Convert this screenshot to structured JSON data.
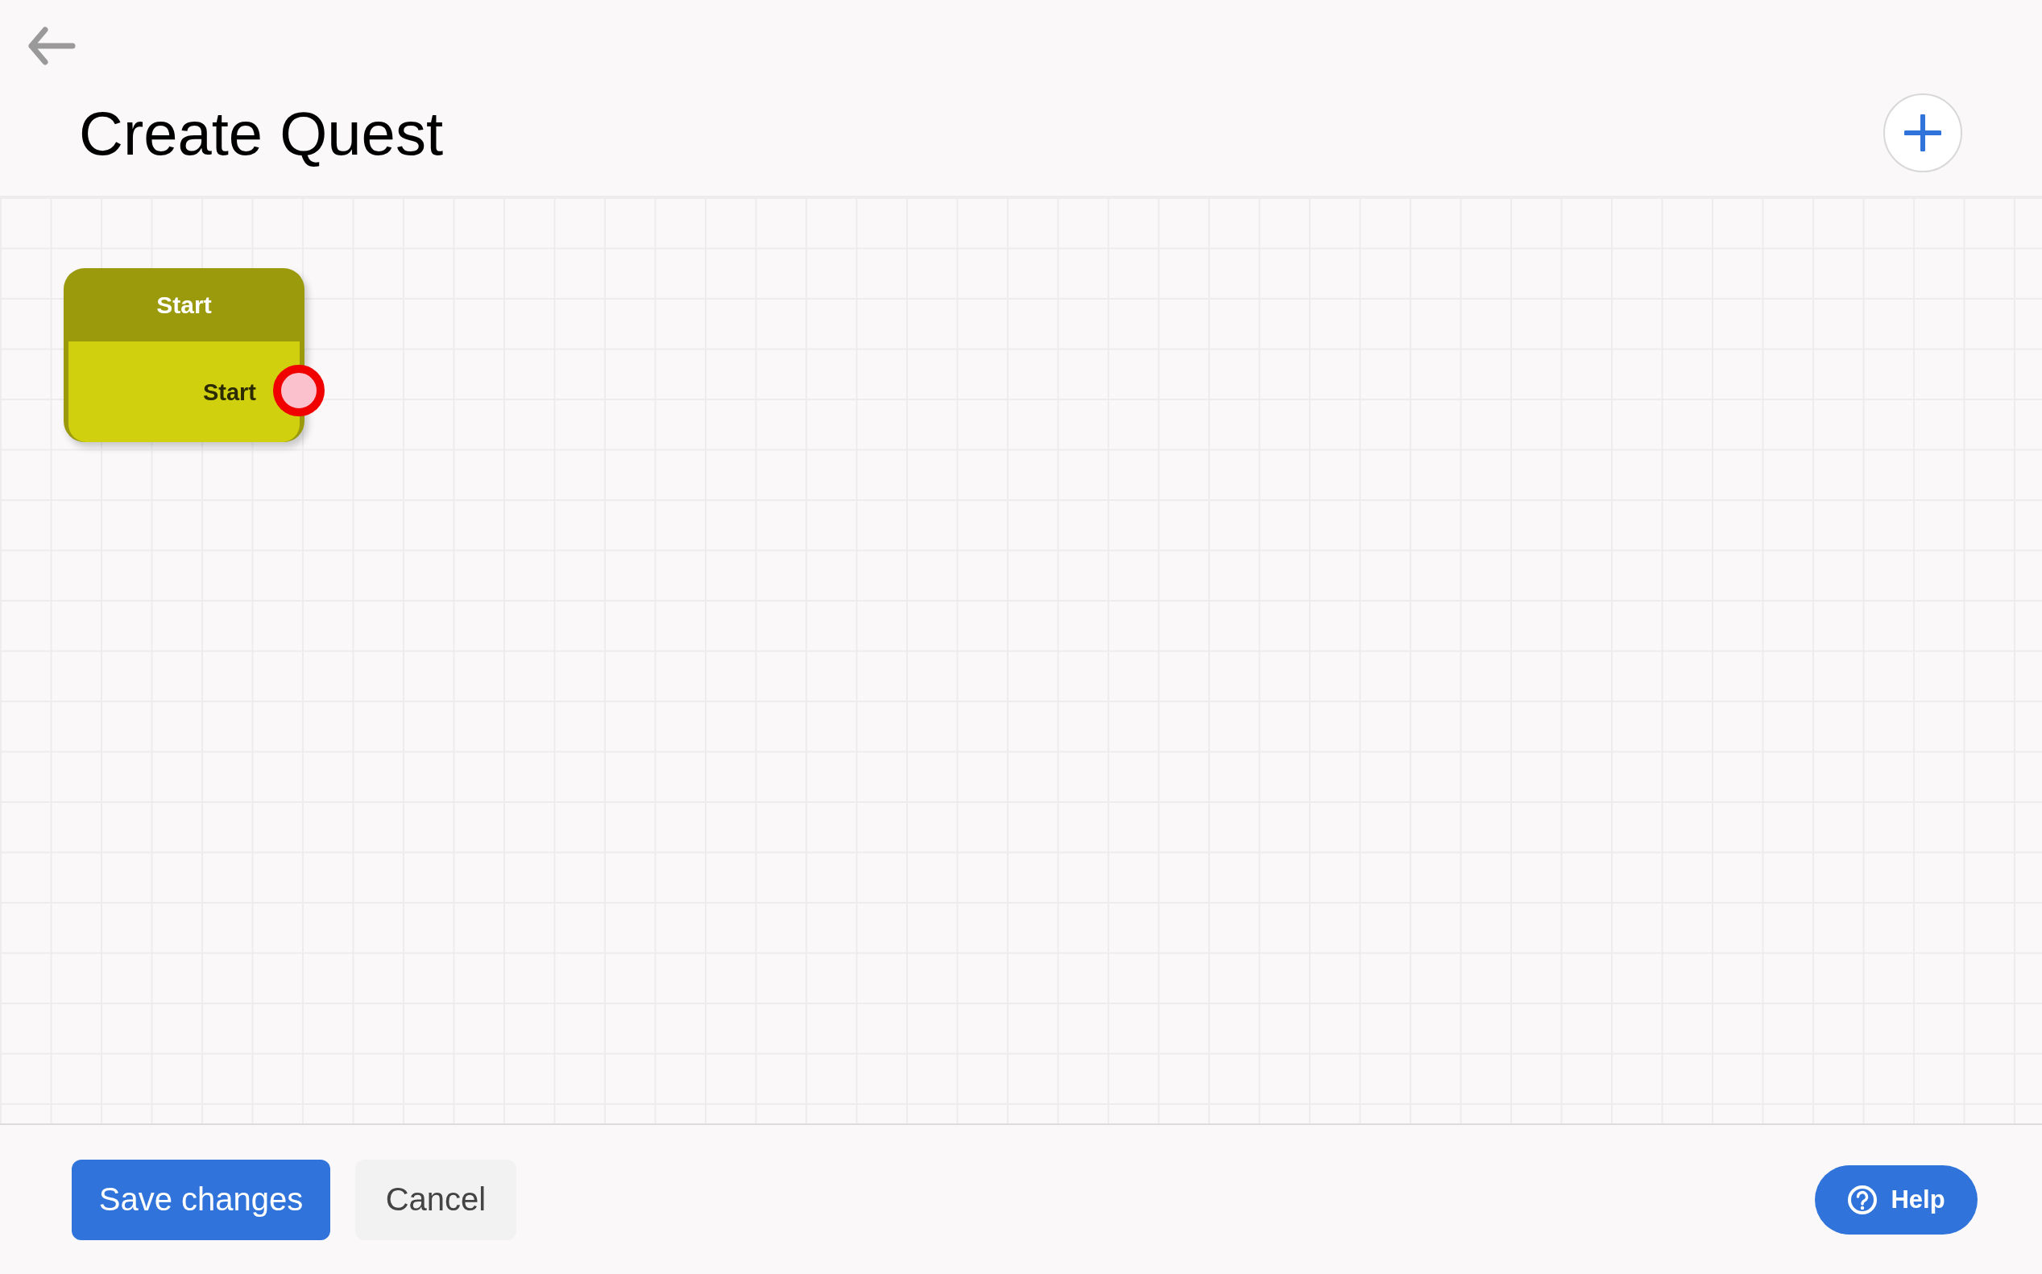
{
  "header": {
    "title": "Create Quest"
  },
  "canvas": {
    "nodes": [
      {
        "title": "Start",
        "outputs": [
          {
            "label": "Start"
          }
        ]
      }
    ]
  },
  "footer": {
    "buttons": [
      {
        "kind": "primary",
        "label": "Save changes"
      },
      {
        "kind": "secondary",
        "label": "Cancel"
      }
    ],
    "help": {
      "label": "Help"
    }
  }
}
